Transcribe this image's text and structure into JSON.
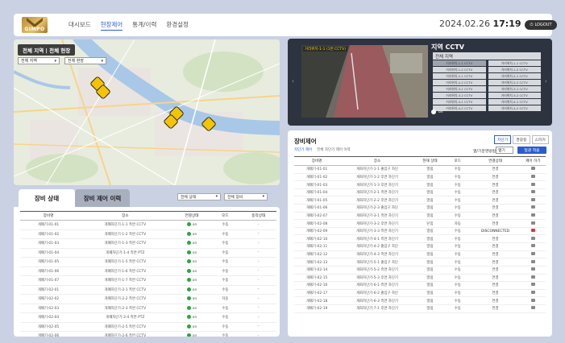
{
  "header": {
    "logo_text": "GIMPO",
    "nav": [
      "대시보드",
      "현장제어",
      "통계/이력",
      "환경설정"
    ],
    "active_nav": 1,
    "date": "2024.02.26",
    "time": "17:19",
    "logout_label": "LOGOUT"
  },
  "map": {
    "region_label": "전체 지역 | 전체 현장",
    "select_region": "전체 지역",
    "select_site": "전체 현장"
  },
  "cctv": {
    "title": "지역 CCTV",
    "all_label": "전체 지역",
    "video_label": "거리위치-1-1 (1번 CCTV)",
    "toggle_label": "on",
    "items": [
      "거리위치-1-1 CCTV",
      "거리위치-1-1 CCTV",
      "거리위치-1-2 CCTV",
      "거리위치-1-2 CCTV",
      "거리위치-2-1 CCTV",
      "거리위치-2-1 CCTV",
      "거리위치-2-2 CCTV",
      "거리위치-2-2 CCTV",
      "거리위치-3-1 CCTV",
      "거리위치-3-1 CCTV",
      "거리위치-3-2 CCTV",
      "거리위치-3-2 CCTV",
      "거리위치-4-1 CCTV",
      "거리위치-4-1 CCTV",
      "거리위치-4-2 CCTV",
      "거리위치-4-2 CCTV"
    ]
  },
  "control": {
    "title": "장비제어",
    "tabs": [
      "차단기",
      "경광등",
      "스피커"
    ],
    "sub_tabs": [
      "차단기 제어",
      "전체 차단기 제어 이력"
    ],
    "filter_label": "열/기운영방법",
    "filter_value": "열기",
    "apply_button": "일괄 적용",
    "columns": [
      "장비명",
      "장소",
      "현재 상태",
      "모드",
      "연결상태",
      "제어 하기"
    ],
    "rows": [
      [
        "개폐기-01-01",
        "개화차단기-1-1 출입구 차단",
        "열림",
        "수동",
        "연결",
        "edit"
      ],
      [
        "개폐기-01-02",
        "개화차단기-1-2 후면 차단기",
        "열림",
        "수동",
        "연결",
        "edit"
      ],
      [
        "개폐기-01-03",
        "개화차단기-1-3 후면 차단기",
        "열림",
        "수동",
        "연결",
        "edit"
      ],
      [
        "개폐기-01-04",
        "개화차단기-2-1 측면 차단기",
        "열림",
        "수동",
        "연결",
        "edit"
      ],
      [
        "개폐기-01-05",
        "개화차단기-2-2 후면 차단기",
        "열림",
        "수동",
        "연결",
        "edit"
      ],
      [
        "개폐기-01-06",
        "개화차단기-2-3 출입구 차단",
        "열림",
        "수동",
        "연결",
        "edit"
      ],
      [
        "개폐기-02-07",
        "개화차단기-3-1 측면 차단기",
        "열림",
        "수동",
        "연결",
        "edit"
      ],
      [
        "개폐기-02-08",
        "개화차단기-3-2 후면 차단기",
        "닫힘",
        "자동",
        "연결",
        "edit"
      ],
      [
        "개폐기-02-09",
        "개화차단기-3-3 측면 차단기",
        "열림",
        "수동",
        "DISCONNECTED",
        "edit-red"
      ],
      [
        "개폐기-02-10",
        "개화차단기-4-1 측면 차단기",
        "열림",
        "수동",
        "연결",
        "edit"
      ],
      [
        "개폐기-02-11",
        "개화차단기-4-2 출입구 차단",
        "열림",
        "수동",
        "연결",
        "edit"
      ],
      [
        "개폐기-02-12",
        "개화차단기-4-3 측면 차단기",
        "열림",
        "수동",
        "연결",
        "edit"
      ],
      [
        "개폐기-02-13",
        "개화차단기-5-1 출입구 차단",
        "열림",
        "수동",
        "연결",
        "edit"
      ],
      [
        "개폐기-02-14",
        "개화차단기-5-2 측면 차단기",
        "열림",
        "수동",
        "연결",
        "edit"
      ],
      [
        "개폐기-02-15",
        "개화차단기-5-3 후면 차단기",
        "열림",
        "수동",
        "연결",
        "edit"
      ],
      [
        "개폐기-02-16",
        "개화차단기-6-1 측면 차단기",
        "열림",
        "수동",
        "연결",
        "edit"
      ],
      [
        "개폐기-02-17",
        "개화차단기-6-2 출입구 차단",
        "열림",
        "수동",
        "연결",
        "edit"
      ],
      [
        "개폐기-02-18",
        "개화차단기-6-3 측면 차단기",
        "열림",
        "수동",
        "연결",
        "edit"
      ],
      [
        "개폐기-02-19",
        "개화차단기-7-1 후면 차단기",
        "열림",
        "수동",
        "연결",
        "edit"
      ]
    ]
  },
  "status": {
    "tab_active": "장비 상태",
    "tab_inactive": "장비 제어 이력",
    "select_status": "전체 상태",
    "select_type": "전체 장비",
    "columns": [
      "장비명",
      "장소",
      "연결상태",
      "모드",
      "동작상태"
    ],
    "rows": [
      [
        "개폐기-01-01",
        "개폐차단기-1-1 측면 CCTV",
        "on",
        "수동",
        "-"
      ],
      [
        "개폐기-01-02",
        "개폐차단기-1-2 측면 CCTV",
        "on",
        "수동",
        "-"
      ],
      [
        "개폐기-01-03",
        "개폐차단기-1-3 측면 CCTV",
        "on",
        "수동",
        "-"
      ],
      [
        "개폐기-01-04",
        "개폐차단기-1-4 측면 PTZ",
        "on",
        "수동",
        "-"
      ],
      [
        "개폐기-01-05",
        "개폐차단기-1-5 측면 CCTV",
        "on",
        "수동",
        "-"
      ],
      [
        "개폐기-01-06",
        "개폐차단기-1-6 측면 CCTV",
        "on",
        "수동",
        "-"
      ],
      [
        "개폐기-01-07",
        "개폐차단기-1-7 측면 CCTV",
        "on",
        "수동",
        "-"
      ],
      [
        "개폐기-02-01",
        "개폐차단기-2-1 측면 CCTV",
        "on",
        "수동",
        "-"
      ],
      [
        "개폐기-02-02",
        "개폐차단기-2-2 측면 CCTV",
        "on",
        "자동",
        "-"
      ],
      [
        "개폐기-02-03",
        "개폐차단기-2-3 측면 CCTV",
        "on",
        "수동",
        "-"
      ],
      [
        "개폐기-02-04",
        "개폐차단기-2-4 측면 PTZ",
        "on",
        "수동",
        "-"
      ],
      [
        "개폐기-02-05",
        "개폐차단기-2-5 측면 CCTV",
        "on",
        "수동",
        "-"
      ],
      [
        "개폐기-02-06",
        "개폐차단기-2-6 측면 CCTV",
        "on",
        "수동",
        "-"
      ]
    ]
  }
}
